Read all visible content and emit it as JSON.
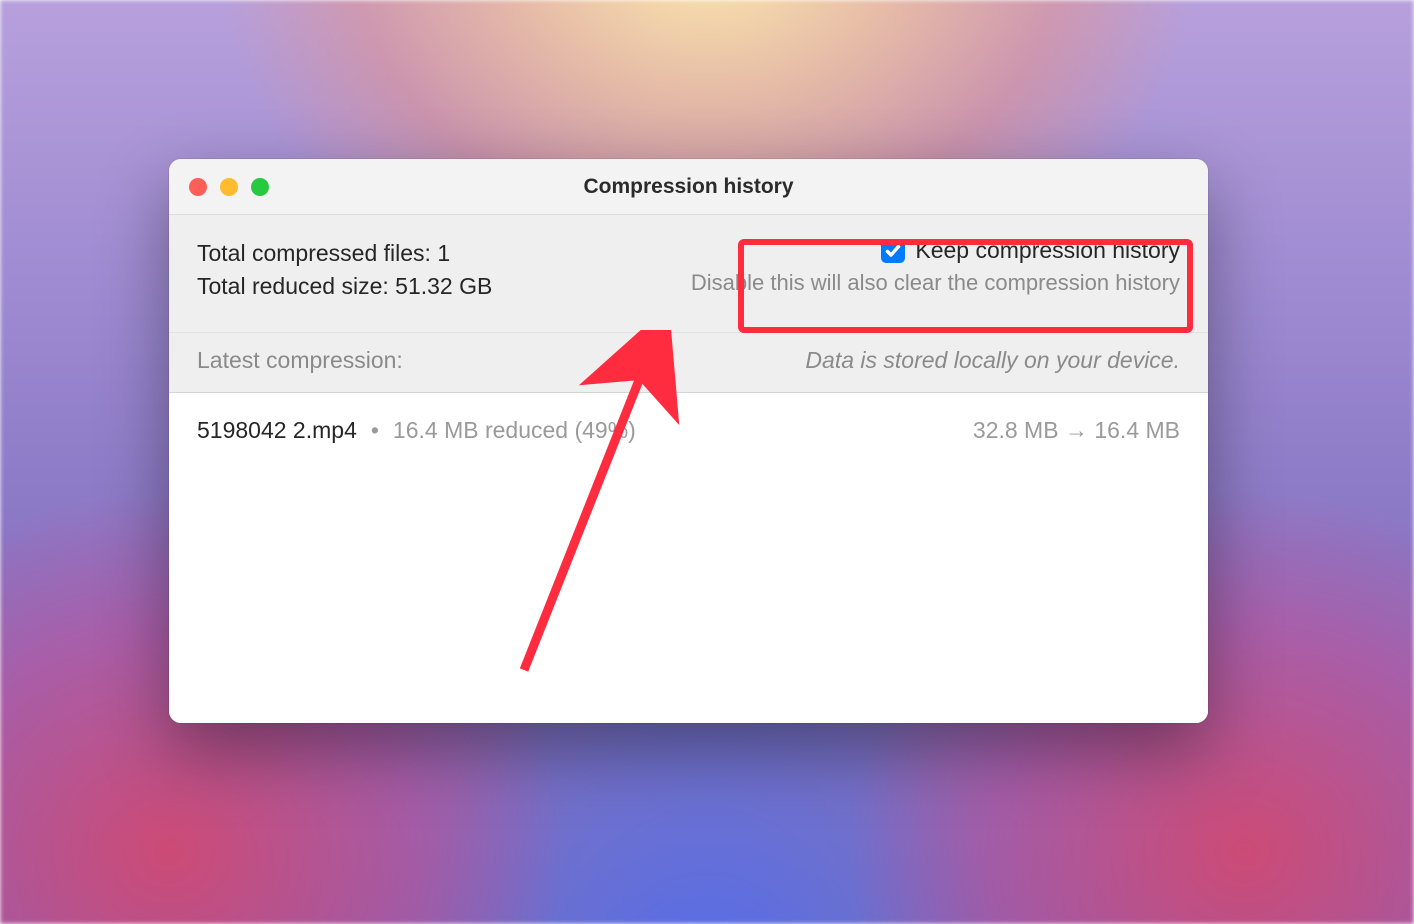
{
  "window": {
    "title": "Compression history"
  },
  "totals": {
    "files_label": "Total compressed files: 1",
    "reduced_label": "Total reduced size: 51.32 GB"
  },
  "keep": {
    "label": "Keep compression history",
    "checked": true,
    "hint": "Disable this will also clear the compression history"
  },
  "subheader": {
    "left": "Latest compression:",
    "right": "Data is stored locally on your device."
  },
  "items": [
    {
      "filename": "5198042 2.mp4",
      "reduced": "16.4 MB reduced (49%)",
      "sizes": "32.8 MB → 16.4 MB"
    }
  ],
  "annotation": {
    "color": "#ff2b3f"
  }
}
